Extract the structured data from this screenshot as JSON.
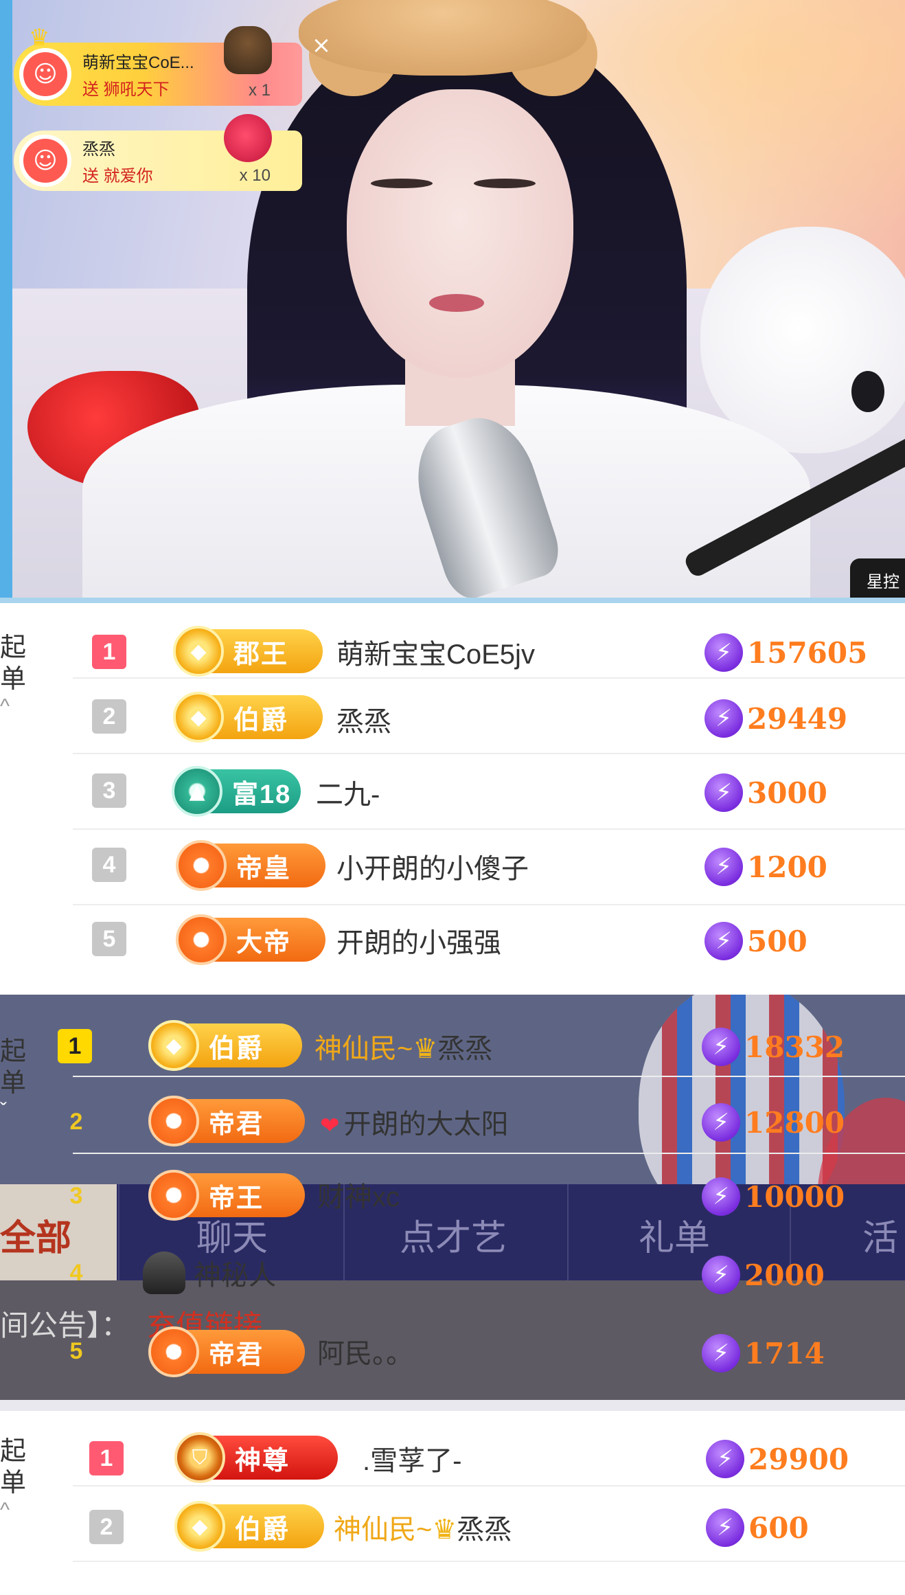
{
  "video": {
    "corner_tag": "星控",
    "close_icon": "×",
    "gifts": [
      {
        "user": "萌新宝宝CoE...",
        "action": "送 狮吼天下",
        "count": "x 1"
      },
      {
        "user": "烝烝",
        "action": "送 就爱你",
        "count": "x 10"
      }
    ]
  },
  "panel1": {
    "side_label": [
      "起",
      "单"
    ],
    "rows": [
      {
        "rank": "1",
        "badge": "郡王",
        "badge_style": "gold",
        "name": "萌新宝宝CoE5jv",
        "score": "157605"
      },
      {
        "rank": "2",
        "badge": "伯爵",
        "badge_style": "gold",
        "name": "烝烝",
        "score": "29449"
      },
      {
        "rank": "3",
        "badge": "富18",
        "badge_style": "teal",
        "name": "二九-",
        "score": "3000"
      },
      {
        "rank": "4",
        "badge": "帝皇",
        "badge_style": "orange",
        "name": "小开朗的小傻子",
        "score": "1200"
      },
      {
        "rank": "5",
        "badge": "大帝",
        "badge_style": "orange",
        "name": "开朗的小强强",
        "score": "500"
      }
    ]
  },
  "panel2": {
    "side_label": [
      "起",
      "单"
    ],
    "rows": [
      {
        "rank": "1",
        "badge": "伯爵",
        "badge_style": "gold",
        "name_prefix": "神仙民~",
        "name": "烝烝",
        "score": "18332"
      },
      {
        "rank": "2",
        "badge": "帝君",
        "badge_style": "orange",
        "name": "开朗的大太阳",
        "score": "12800"
      },
      {
        "rank": "3",
        "badge": "帝王",
        "badge_style": "orange",
        "name": "财神xc",
        "score": "10000"
      },
      {
        "rank": "4",
        "badge": "",
        "badge_style": "none",
        "name": "神秘人",
        "score": "2000"
      },
      {
        "rank": "5",
        "badge": "帝君",
        "badge_style": "orange",
        "name": "阿民。。",
        "score": "1714"
      }
    ],
    "underlay_tabs": [
      "全部",
      "聊天",
      "点才艺",
      "礼单",
      "活"
    ],
    "underlay_announce": "间公告】：",
    "underlay_link": "充值链接"
  },
  "panel3": {
    "side_label": [
      "起",
      "单"
    ],
    "rows": [
      {
        "rank": "1",
        "badge": "神尊",
        "badge_style": "red",
        "name": ".雪莩了-",
        "score": "29900"
      },
      {
        "rank": "2",
        "badge": "伯爵",
        "badge_style": "gold",
        "name_prefix": "神仙民~",
        "name": "烝烝",
        "score": "600"
      }
    ]
  },
  "colors": {
    "rank_top": "#ff5a72",
    "score_orange": "#ff7d1f",
    "bolt_purple": "#7a2ddf",
    "divider_blue": "#a9d4ee"
  }
}
